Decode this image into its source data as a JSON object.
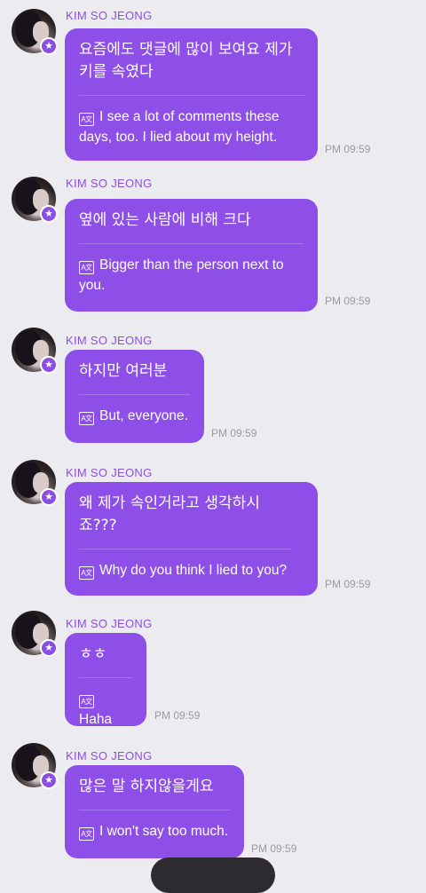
{
  "messages": [
    {
      "sender": "KIM SO JEONG",
      "korean": "요즘에도 댓글에 많이 보여요 제가 키를 속였다",
      "translation": "I see a lot of comments these days, too. I lied about my height.",
      "time": "PM 09:59"
    },
    {
      "sender": "KIM SO JEONG",
      "korean": "옆에 있는 사람에 비해 크다",
      "translation": "Bigger than the person next to you.",
      "time": "PM 09:59"
    },
    {
      "sender": "KIM SO JEONG",
      "korean": "하지만 여러분",
      "translation": "But, everyone.",
      "time": "PM 09:59"
    },
    {
      "sender": "KIM SO JEONG",
      "korean": "왜 제가 속인거라고 생각하시죠???",
      "translation": "Why do you think I lied to you?",
      "time": "PM 09:59"
    },
    {
      "sender": "KIM SO JEONG",
      "korean": "ㅎㅎ",
      "translation": "Haha",
      "time": "PM 09:59"
    },
    {
      "sender": "KIM SO JEONG",
      "korean": "많은 말 하지않을게요",
      "translation": "I won't say too much.",
      "time": "PM 09:59"
    }
  ],
  "icons": {
    "translate": "translate-icon",
    "badge": "star-icon"
  },
  "colors": {
    "bubble": "#8d4fe8",
    "sender": "#8a4fe4",
    "background": "#ecebf0",
    "timestamp": "#9c9aa2"
  }
}
